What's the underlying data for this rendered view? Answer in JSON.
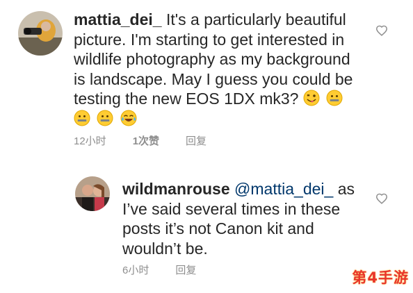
{
  "comment": {
    "username": "mattia_dei_",
    "text": "It's a particularly beautiful picture. I'm starting to get interested in wildlife photography as my background is landscape. May I guess you could be testing the new EOS  1DX mk3?",
    "emojis": [
      "face-with-tongue-wink",
      "zipper-mouth-face",
      "zipper-mouth-face",
      "zipper-mouth-face",
      "tears-of-joy-face"
    ],
    "time": "12小时",
    "likes": "1次赞",
    "reply_label": "回复"
  },
  "reply": {
    "username": "wildmanrouse",
    "mention": "@mattia_dei_",
    "text": "as I’ve said several times in these posts it’s not Canon kit and wouldn’t be.",
    "time": "6小时",
    "reply_label": "回复"
  },
  "watermark": "第4手游",
  "colors": {
    "text": "#262626",
    "meta": "#8e8e8e",
    "mention": "#00376b",
    "watermark": "#e8352b"
  },
  "icons": [
    "avatar-mattia",
    "avatar-wildmanrouse",
    "heart-outline-icon"
  ]
}
